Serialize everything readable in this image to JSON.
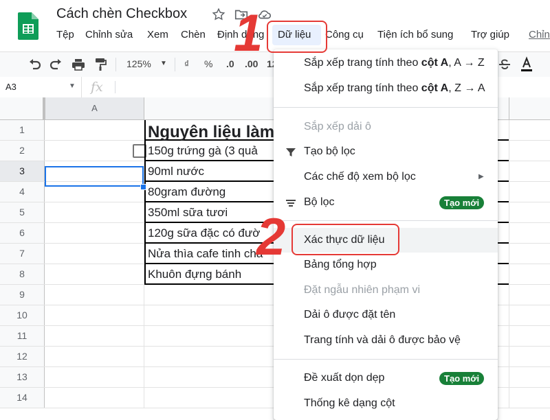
{
  "title": "Cách chèn Checkbox",
  "menu": [
    "Tệp",
    "Chỉnh sửa",
    "Xem",
    "Chèn",
    "Định dạng",
    "Dữ liệu",
    "Công cụ",
    "Tiện ích bổ sung",
    "Trợ giúp",
    "Chỉn"
  ],
  "toolbar": {
    "zoom": "125%",
    "currency": "₫",
    "percent": "%",
    "dec_decrease": ".0",
    "dec_increase": ".00",
    "more_formats": "12"
  },
  "formula_bar": {
    "name_box": "A3",
    "fx": "fx"
  },
  "grid": {
    "columns": [
      "A"
    ],
    "rows": [
      "1",
      "2",
      "3",
      "4",
      "5",
      "6",
      "7",
      "8",
      "9",
      "10",
      "11",
      "12",
      "13",
      "14"
    ],
    "cells_b": [
      "Nguyên liệu làm",
      "150g trứng gà (3 quả",
      "90ml nước",
      "80gram đường",
      "350ml sữa tươi",
      "120g sữa đặc có đườ",
      "Nửa thìa cafe tinh chấ",
      "Khuôn đựng bánh"
    ],
    "selected_cell": "A3"
  },
  "dropdown": {
    "items": [
      {
        "label_pre": "Sắp xếp trang tính theo ",
        "label_bold": "cột A",
        "label_post": ", A → Z"
      },
      {
        "label_pre": "Sắp xếp trang tính theo ",
        "label_bold": "cột A",
        "label_post": ", Z → A"
      },
      {
        "label": "Sắp xếp dải ô"
      },
      {
        "label": "Tạo bộ lọc",
        "icon": "filter-icon"
      },
      {
        "label": "Các chế độ xem bộ lọc"
      },
      {
        "label": "Bộ lọc",
        "icon": "slicer-icon",
        "badge": "Tạo mới"
      },
      {
        "label": "Xác thực dữ liệu"
      },
      {
        "label": "Bảng tổng hợp"
      },
      {
        "label": "Đặt ngẫu nhiên phạm vi"
      },
      {
        "label": "Dải ô được đặt tên"
      },
      {
        "label": "Trang tính và dải ô được bảo vệ"
      },
      {
        "label": "Đề xuất dọn dẹp",
        "badge": "Tạo mới"
      },
      {
        "label": "Thống kê dạng cột"
      }
    ]
  },
  "annotations": [
    "1",
    "2"
  ],
  "colors": {
    "accent": "#1a73e8",
    "annotation": "#e53935",
    "badge": "#188038",
    "sheets_green": "#0f9d58"
  }
}
